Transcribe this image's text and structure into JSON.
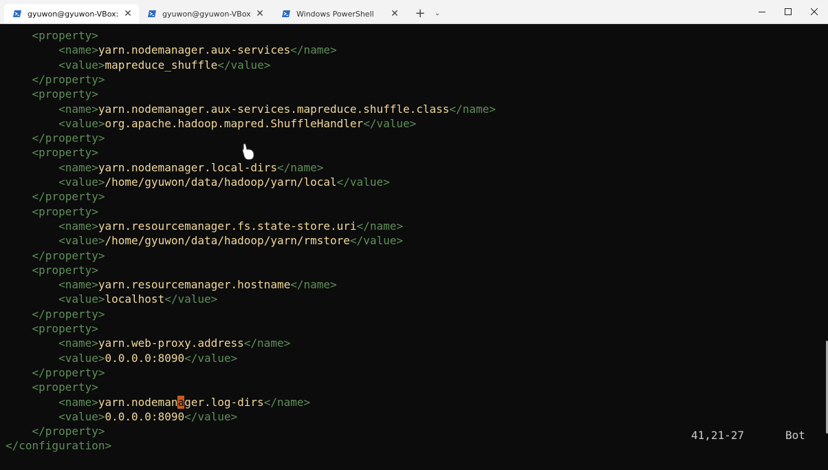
{
  "window": {
    "tabs": [
      {
        "label": "gyuwon@gyuwon-VBox: ~/h",
        "active": true
      },
      {
        "label": "gyuwon@gyuwon-VBox: ~/da",
        "active": false
      },
      {
        "label": "Windows PowerShell",
        "active": false
      }
    ],
    "close_glyph": "✕",
    "new_tab_glyph": "+",
    "dropdown_glyph": "⌄"
  },
  "editor": {
    "lines": [
      {
        "indent": "    ",
        "open": "<property>",
        "text": "",
        "close": ""
      },
      {
        "indent": "        ",
        "open": "<name>",
        "text": "yarn.nodemanager.aux-services",
        "close": "</name>"
      },
      {
        "indent": "        ",
        "open": "<value>",
        "text": "mapreduce_shuffle",
        "close": "</value>"
      },
      {
        "indent": "    ",
        "open": "</property>",
        "text": "",
        "close": ""
      },
      {
        "indent": "    ",
        "open": "<property>",
        "text": "",
        "close": ""
      },
      {
        "indent": "        ",
        "open": "<name>",
        "text": "yarn.nodemanager.aux-services.mapreduce.shuffle.class",
        "close": "</name>"
      },
      {
        "indent": "        ",
        "open": "<value>",
        "text": "org.apache.hadoop.mapred.ShuffleHandler",
        "close": "</value>"
      },
      {
        "indent": "    ",
        "open": "</property>",
        "text": "",
        "close": ""
      },
      {
        "indent": "    ",
        "open": "<property>",
        "text": "",
        "close": ""
      },
      {
        "indent": "        ",
        "open": "<name>",
        "text": "yarn.nodemanager.local-dirs",
        "close": "</name>"
      },
      {
        "indent": "        ",
        "open": "<value>",
        "text": "/home/gyuwon/data/hadoop/yarn/local",
        "close": "</value>"
      },
      {
        "indent": "    ",
        "open": "</property>",
        "text": "",
        "close": ""
      },
      {
        "indent": "    ",
        "open": "<property>",
        "text": "",
        "close": ""
      },
      {
        "indent": "        ",
        "open": "<name>",
        "text": "yarn.resourcemanager.fs.state-store.uri",
        "close": "</name>"
      },
      {
        "indent": "        ",
        "open": "<value>",
        "text": "/home/gyuwon/data/hadoop/yarn/rmstore",
        "close": "</value>"
      },
      {
        "indent": "    ",
        "open": "</property>",
        "text": "",
        "close": ""
      },
      {
        "indent": "    ",
        "open": "<property>",
        "text": "",
        "close": ""
      },
      {
        "indent": "        ",
        "open": "<name>",
        "text": "yarn.resourcemanager.hostname",
        "close": "</name>"
      },
      {
        "indent": "        ",
        "open": "<value>",
        "text": "localhost",
        "close": "</value>"
      },
      {
        "indent": "    ",
        "open": "</property>",
        "text": "",
        "close": ""
      },
      {
        "indent": "    ",
        "open": "<property>",
        "text": "",
        "close": ""
      },
      {
        "indent": "        ",
        "open": "<name>",
        "text": "yarn.web-proxy.address",
        "close": "</name>"
      },
      {
        "indent": "        ",
        "open": "<value>",
        "text": "0.0.0.0:8090",
        "close": "</value>"
      },
      {
        "indent": "    ",
        "open": "</property>",
        "text": "",
        "close": ""
      },
      {
        "indent": "    ",
        "open": "<property>",
        "text": "",
        "close": ""
      },
      {
        "indent": "        ",
        "open": "<name>",
        "text": "yarn.nodemanager.log-dirs",
        "close": "</name>",
        "cursor_col": 12
      },
      {
        "indent": "        ",
        "open": "<value>",
        "text": "0.0.0.0:8090",
        "close": "</value>"
      },
      {
        "indent": "    ",
        "open": "</property>",
        "text": "",
        "close": ""
      },
      {
        "indent": "",
        "open": "</configuration>",
        "text": "",
        "close": ""
      }
    ],
    "status": {
      "position": "41,21-27",
      "scroll": "Bot"
    }
  },
  "colors": {
    "background": "#0c0c0c",
    "tag": "#5f8f5a",
    "content": "#f1d89c",
    "cursor": "#c85a1e"
  },
  "icons": {
    "tab_icon": "powershell-icon",
    "pointer": "hand-pointer-icon"
  }
}
